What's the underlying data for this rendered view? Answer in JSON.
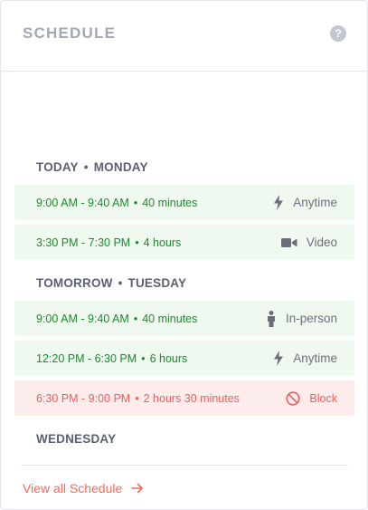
{
  "header": {
    "title": "SCHEDULE",
    "help_glyph": "?"
  },
  "days": [
    {
      "label": "TODAY",
      "weekday": "MONDAY"
    },
    {
      "label": "TOMORROW",
      "weekday": "TUESDAY"
    },
    {
      "label": "",
      "weekday": "WEDNESDAY"
    }
  ],
  "separator": "•",
  "slots": [
    {
      "time": "9:00 AM - 9:40 AM",
      "duration": "40 minutes",
      "type": "Anytime",
      "icon": "bolt-icon",
      "status": "available"
    },
    {
      "time": "3:30 PM - 7:30 PM",
      "duration": "4 hours",
      "type": "Video",
      "icon": "video-icon",
      "status": "available"
    },
    {
      "time": "9:00 AM - 9:40 AM",
      "duration": "40 minutes",
      "type": "In-person",
      "icon": "person-icon",
      "status": "available"
    },
    {
      "time": "12:20 PM - 6:30 PM",
      "duration": "6 hours",
      "type": "Anytime",
      "icon": "bolt-icon",
      "status": "available"
    },
    {
      "time": "6:30 PM - 9:00 PM",
      "duration": "2 hours 30 minutes",
      "type": "Block",
      "icon": "block-icon",
      "status": "blocked"
    }
  ],
  "footer": {
    "view_all_label": "View all Schedule"
  },
  "colors": {
    "available_bg": "#f0f9ef",
    "available_text": "#1a8a2c",
    "blocked_bg": "#fdecec",
    "blocked_text": "#ec5f5f",
    "accent": "#ef6b5c"
  }
}
